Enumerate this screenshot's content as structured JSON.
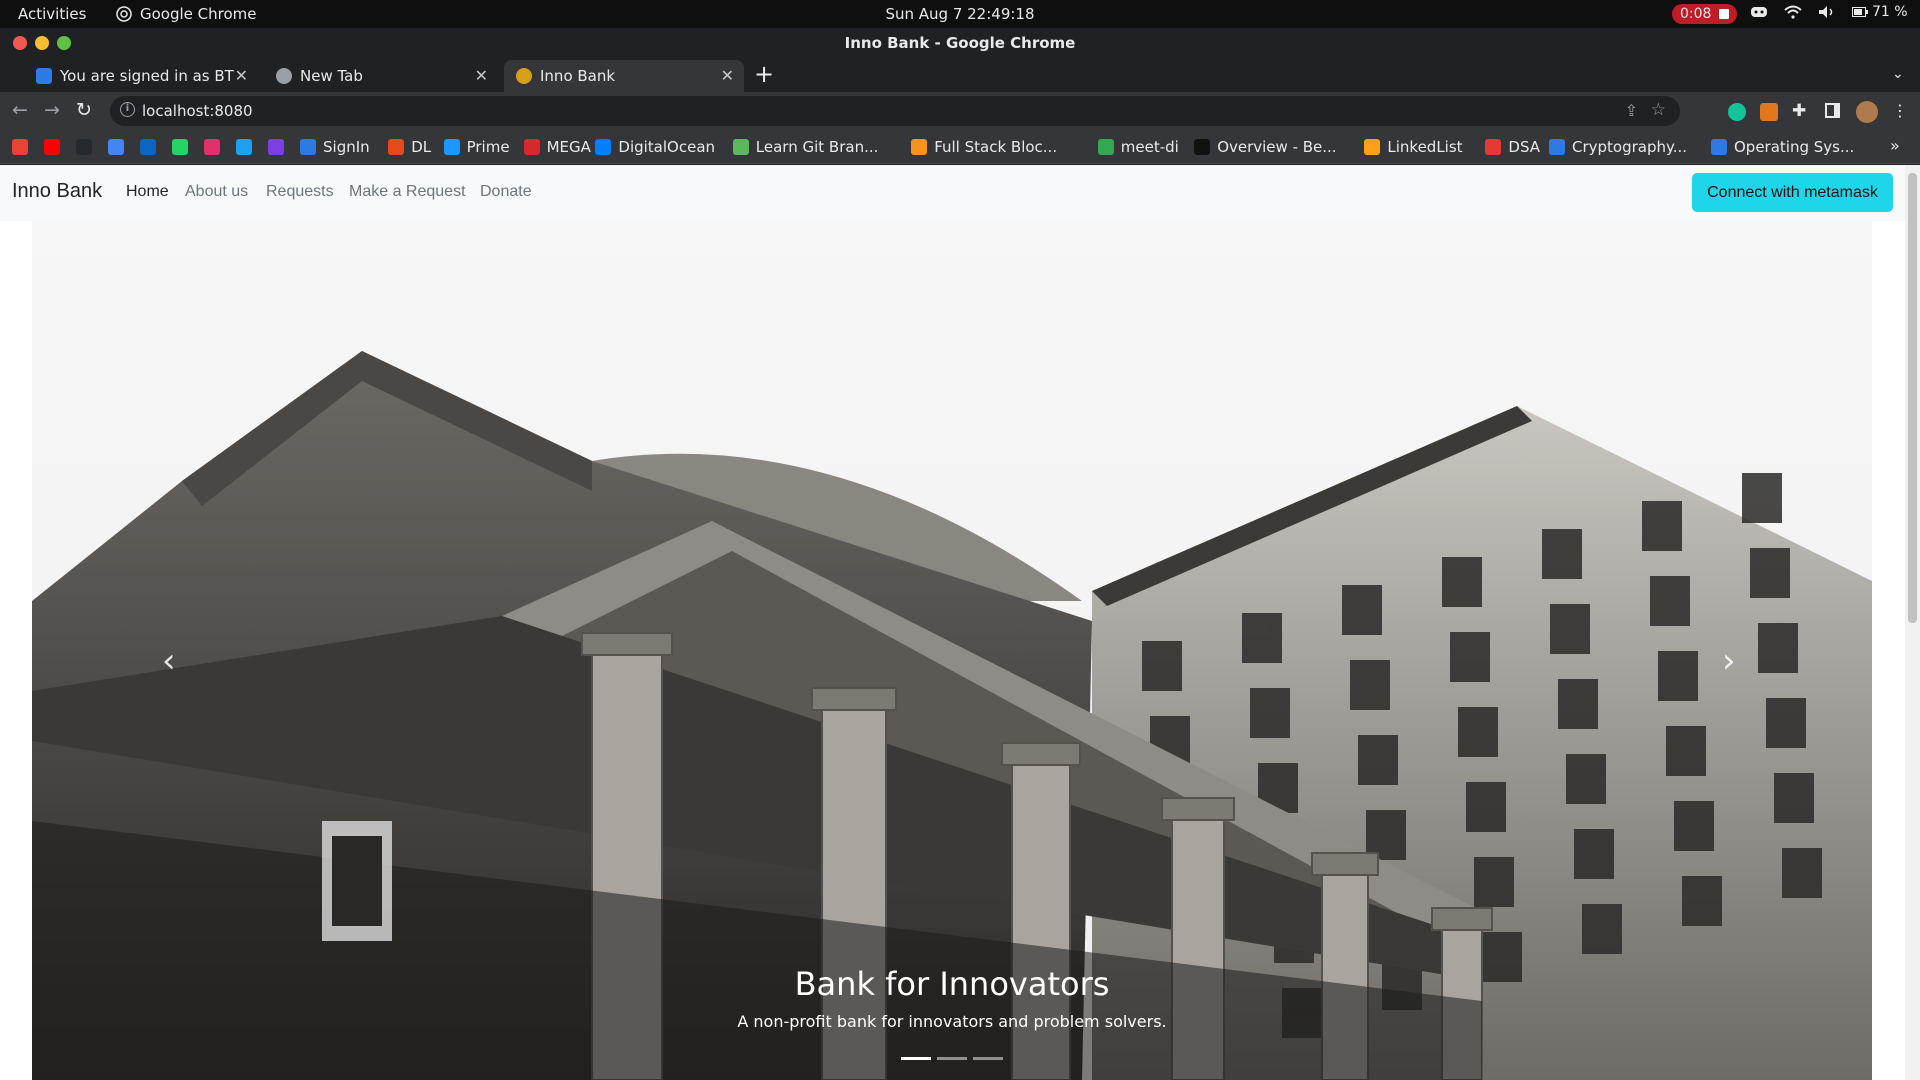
{
  "os_bar": {
    "activities": "Activities",
    "app_name": "Google Chrome",
    "clock": "Sun Aug 7  22:49:18",
    "recording_time": "0:08",
    "battery": "71 %"
  },
  "window": {
    "title": "Inno Bank - Google Chrome"
  },
  "tabs": [
    {
      "label": "You are signed in as BTEC",
      "favicon_color": "#2c7be5"
    },
    {
      "label": "New Tab",
      "favicon_color": "#9aa0a6"
    },
    {
      "label": "Inno Bank",
      "favicon_color": "#d4a017"
    }
  ],
  "omnibox": {
    "url": "localhost:8080"
  },
  "bookmarks": [
    {
      "label": "",
      "color": "#ea4335",
      "icon": "gmail-icon"
    },
    {
      "label": "",
      "color": "#ff0000",
      "icon": "youtube-icon"
    },
    {
      "label": "",
      "color": "#24292e",
      "icon": "github-icon"
    },
    {
      "label": "",
      "color": "#4285f4",
      "icon": "docs-icon"
    },
    {
      "label": "",
      "color": "#0a66c2",
      "icon": "linkedin-icon"
    },
    {
      "label": "",
      "color": "#25d366",
      "icon": "whatsapp-icon"
    },
    {
      "label": "",
      "color": "#e1306c",
      "icon": "instagram-icon"
    },
    {
      "label": "",
      "color": "#1da1f2",
      "icon": "twitter-icon"
    },
    {
      "label": "",
      "color": "#7b3fe4",
      "icon": "polygon-icon"
    },
    {
      "label": "SignIn",
      "color": "#2c7be5",
      "icon": "signin-icon"
    },
    {
      "label": "DL",
      "color": "#e64a19",
      "icon": "dl-icon"
    },
    {
      "label": "Prime",
      "color": "#1a98ff",
      "icon": "prime-icon"
    },
    {
      "label": "MEGA",
      "color": "#d9272e",
      "icon": "mega-icon"
    },
    {
      "label": "DigitalOcean",
      "color": "#0080ff",
      "icon": "digitalocean-icon"
    },
    {
      "label": "Learn Git Bran...",
      "color": "#5cb85c",
      "icon": "git-icon"
    },
    {
      "label": "Full Stack Bloc...",
      "color": "#f7931a",
      "icon": "blockchain-icon"
    },
    {
      "label": "meet-di",
      "color": "#34a853",
      "icon": "meet-icon"
    },
    {
      "label": "Overview - Be...",
      "color": "#111111",
      "icon": "overview-icon"
    },
    {
      "label": "LinkedList",
      "color": "#ffa116",
      "icon": "leetcode-icon"
    },
    {
      "label": "DSA",
      "color": "#e53935",
      "icon": "dsa-icon"
    },
    {
      "label": "Cryptography...",
      "color": "#2c7be5",
      "icon": "crypto-icon"
    },
    {
      "label": "Operating Sys...",
      "color": "#2c7be5",
      "icon": "os-icon"
    }
  ],
  "site": {
    "brand": "Inno Bank",
    "nav": [
      "Home",
      "About us",
      "Requests",
      "Make a Request",
      "Donate"
    ],
    "active_nav": "Home",
    "connect_button": "Connect with metamask",
    "accent_color": "#1fd5e9"
  },
  "carousel": {
    "title": "Bank for Innovators",
    "text": "A non-profit bank for innovators and problem solvers.",
    "slides": 3,
    "active_slide": 1,
    "image": "bank-building-photo"
  }
}
